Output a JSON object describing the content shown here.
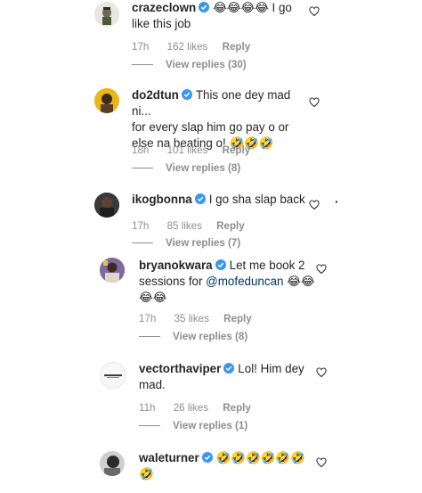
{
  "comments": [
    {
      "username": "crazeclown",
      "text": "😂😂😂😂 I go",
      "text2": "like this job",
      "time": "17h",
      "likes": "162 likes",
      "reply": "Reply",
      "view_replies": "View replies (30)"
    },
    {
      "username": "do2dtun",
      "text": "This one dey mad ni...",
      "text2": "for every slap him go pay o or",
      "text3": "else na beating o! 🤣🤣🤣",
      "time": "18h",
      "likes": "101 likes",
      "reply": "Reply",
      "view_replies": "View replies (8)"
    },
    {
      "username": "ikogbonna",
      "text": "I go sha slap back",
      "time": "17h",
      "likes": "85 likes",
      "reply": "Reply",
      "view_replies": "View replies (7)",
      "more_glyph": "·"
    },
    {
      "username": "bryanokwara",
      "text": "Let me book 2",
      "text2_pre": "sessions for ",
      "mention": "@mofeduncan",
      "text2_post": " 😂😂",
      "text3": "😂😂",
      "time": "17h",
      "likes": "35 likes",
      "reply": "Reply",
      "view_replies": "View replies (8)"
    },
    {
      "username": "vectorthaviper",
      "text": "Lol! Him dey",
      "text2": "mad.",
      "time": "11h",
      "likes": "26 likes",
      "reply": "Reply",
      "view_replies": "View replies (1)"
    },
    {
      "username": "waleturner",
      "text": "🤣🤣🤣🤣🤣🤣",
      "text2": "🤣"
    }
  ],
  "colors": {
    "verified": "#3897f0",
    "mention": "#003569",
    "meta": "#8e8e8e"
  },
  "icons": {
    "verified": "verified-badge-icon",
    "heart": "heart-outline-icon"
  }
}
